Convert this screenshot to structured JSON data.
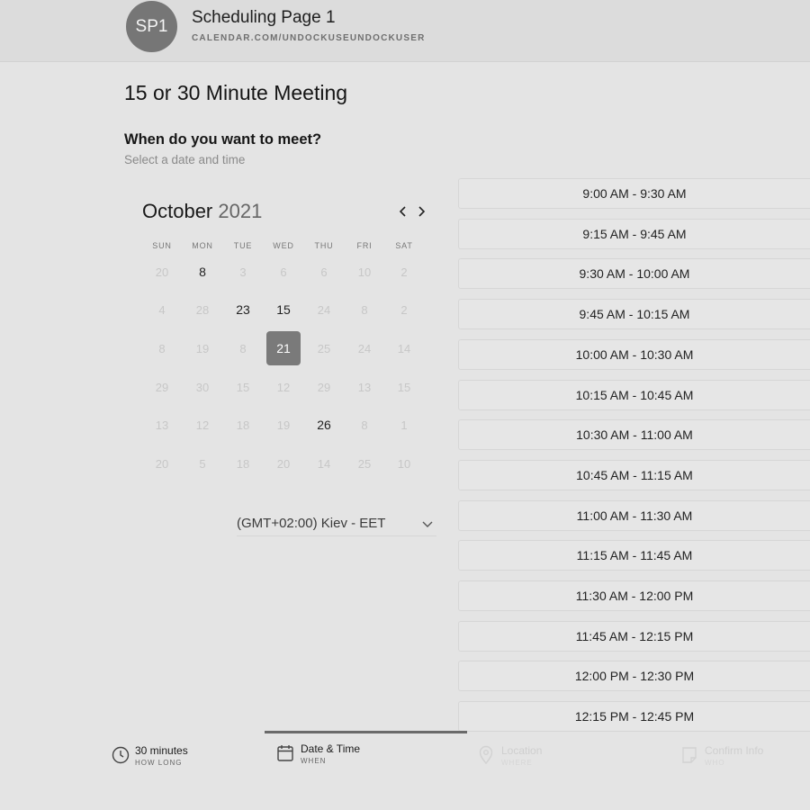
{
  "header": {
    "avatar_initials": "SP1",
    "page_name": "Scheduling Page 1",
    "page_url": "CALENDAR.COM/UNDOCKUSEUNDOCKUSER"
  },
  "event": {
    "title": "15 or 30 Minute Meeting"
  },
  "prompt": {
    "question": "When do you want to meet?",
    "subtitle": "Select a date and time"
  },
  "calendar": {
    "month": "October",
    "year": "2021",
    "prev_icon": "chevron-left-icon",
    "next_icon": "chevron-right-icon",
    "weekdays": [
      "SUN",
      "MON",
      "TUE",
      "WED",
      "THU",
      "FRI",
      "SAT"
    ],
    "weeks": [
      [
        "20",
        "8",
        "3",
        "6",
        "6",
        "10",
        "2"
      ],
      [
        "4",
        "28",
        "23",
        "15",
        "24",
        "8",
        "2"
      ],
      [
        "8",
        "19",
        "8",
        "21",
        "25",
        "24",
        "14"
      ],
      [
        "29",
        "30",
        "15",
        "12",
        "29",
        "13",
        "15"
      ],
      [
        "13",
        "12",
        "18",
        "19",
        "26",
        "8",
        "1"
      ],
      [
        "20",
        "5",
        "18",
        "20",
        "14",
        "25",
        "10"
      ]
    ],
    "available": [
      [
        0,
        1
      ],
      [
        1,
        2
      ],
      [
        1,
        3
      ],
      [
        2,
        3
      ],
      [
        4,
        4
      ]
    ],
    "selected": [
      2,
      3
    ]
  },
  "timezone": {
    "label": "(GMT+02:00) Kiev - EET",
    "icon": "chevron-down-icon"
  },
  "slots": [
    "9:00 AM - 9:30 AM",
    "9:15 AM - 9:45 AM",
    "9:30 AM - 10:00 AM",
    "9:45 AM - 10:15 AM",
    "10:00 AM - 10:30 AM",
    "10:15 AM - 10:45 AM",
    "10:30 AM - 11:00 AM",
    "10:45 AM - 11:15 AM",
    "11:00 AM - 11:30 AM",
    "11:15 AM - 11:45 AM",
    "11:30 AM - 12:00 PM",
    "11:45 AM - 12:15 PM",
    "12:00 PM - 12:30 PM",
    "12:15 PM - 12:45 PM"
  ],
  "steps": [
    {
      "title": "30 minutes",
      "subtitle": "HOW LONG",
      "icon": "clock-icon",
      "state": "done"
    },
    {
      "title": "Date & Time",
      "subtitle": "WHEN",
      "icon": "calendar-icon",
      "state": "active"
    },
    {
      "title": "Location",
      "subtitle": "WHERE",
      "icon": "location-pin-icon",
      "state": "upcoming"
    },
    {
      "title": "Confirm Info",
      "subtitle": "WHO",
      "icon": "note-icon",
      "state": "upcoming"
    }
  ]
}
